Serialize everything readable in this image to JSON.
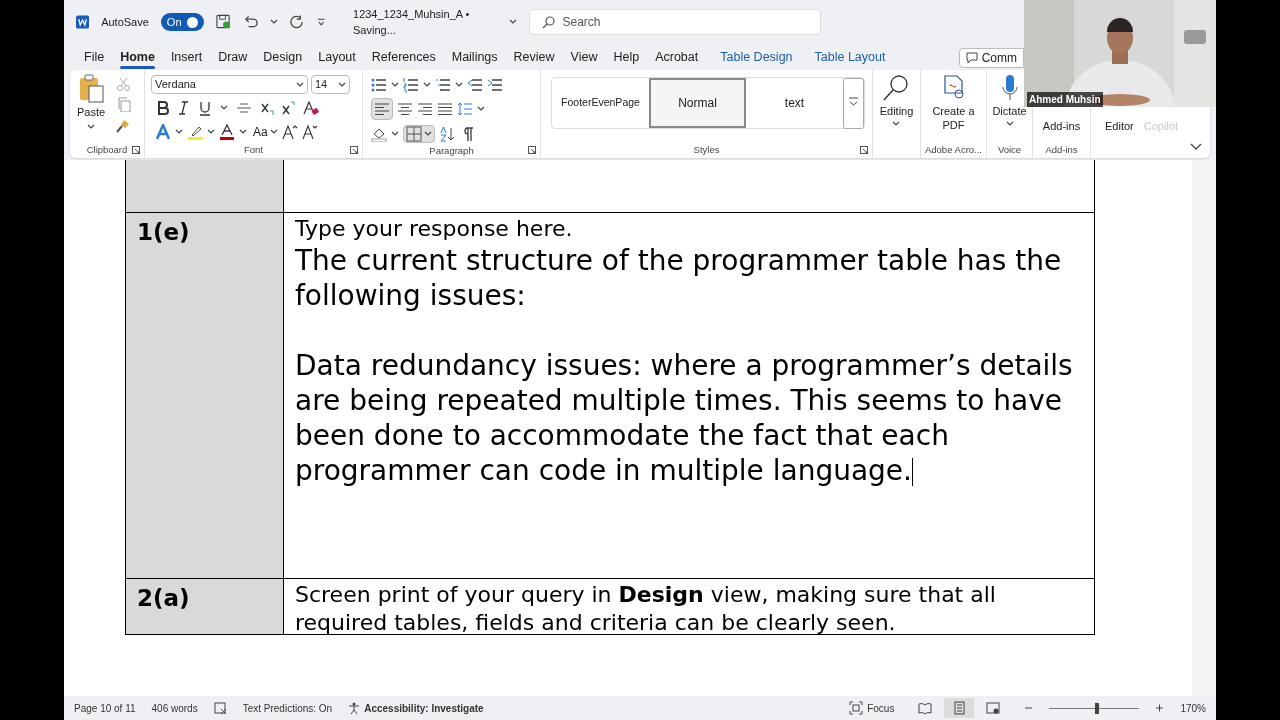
{
  "title_bar": {
    "autosave_label": "AutoSave",
    "autosave_toggle": {
      "label": "On",
      "on": true
    },
    "document_title": "1234_1234_Muhsin_A • Saving...",
    "search": {
      "placeholder": "Search"
    }
  },
  "menu_tabs": [
    {
      "label": "File",
      "selected": false,
      "kind": "normal"
    },
    {
      "label": "Home",
      "selected": true,
      "kind": "normal"
    },
    {
      "label": "Insert",
      "selected": false,
      "kind": "normal"
    },
    {
      "label": "Draw",
      "selected": false,
      "kind": "normal"
    },
    {
      "label": "Design",
      "selected": false,
      "kind": "normal"
    },
    {
      "label": "Layout",
      "selected": false,
      "kind": "normal"
    },
    {
      "label": "References",
      "selected": false,
      "kind": "normal"
    },
    {
      "label": "Mailings",
      "selected": false,
      "kind": "normal"
    },
    {
      "label": "Review",
      "selected": false,
      "kind": "normal"
    },
    {
      "label": "View",
      "selected": false,
      "kind": "normal"
    },
    {
      "label": "Help",
      "selected": false,
      "kind": "normal"
    },
    {
      "label": "Acrobat",
      "selected": false,
      "kind": "normal"
    },
    {
      "label": "Table Design",
      "selected": false,
      "kind": "contextual"
    },
    {
      "label": "Table Layout",
      "selected": false,
      "kind": "contextual"
    }
  ],
  "comments_button": "Comm",
  "ribbon": {
    "clipboard": {
      "paste": "Paste",
      "label": "Clipboard"
    },
    "font": {
      "font_name": "Verdana",
      "font_size": "14",
      "change_case": "Aa",
      "label": "Font"
    },
    "paragraph": {
      "label": "Paragraph"
    },
    "styles": {
      "items": [
        {
          "label": "FooterEvenPage",
          "selected": false
        },
        {
          "label": "Normal",
          "selected": true
        },
        {
          "label": "text",
          "selected": false
        }
      ],
      "label": "Styles"
    },
    "editing": "Editing",
    "create_pdf": "Create a PDF",
    "adobe_label": "Adobe Acro...",
    "dictate": "Dictate",
    "voice_label": "Voice",
    "add_ins": "Add-ins",
    "add_ins_label": "Add-ins",
    "editor": "Editor",
    "copilot": {
      "label": "Copilot",
      "disabled": true
    }
  },
  "video_overlay": {
    "name": "Ahmed Muhsin"
  },
  "document_table": {
    "rows": [
      {
        "label": "",
        "paragraphs": []
      },
      {
        "label": "1(e)",
        "prompt": "Type your response here.",
        "paragraphs": [
          "The current structure of the programmer table has the following issues:",
          "Data redundancy issues: where a programmer’s details are being repeated multiple times. This seems to have been done to accommodate the fact that each programmer can code in multiple language."
        ]
      },
      {
        "label": "2(a)",
        "prompt": "Screen print of your query in **Design** view, making sure that all required tables, fields and criteria can be clearly seen.",
        "paragraphs": []
      }
    ]
  },
  "status_bar": {
    "page": "Page 10 of 11",
    "words": "406 words",
    "text_predictions": "Text Predictions: On",
    "accessibility": "Accessibility: Investigate",
    "focus": "Focus",
    "views": [
      {
        "kind": "read",
        "selected": false
      },
      {
        "kind": "print",
        "selected": true
      },
      {
        "kind": "web",
        "selected": false
      }
    ],
    "zoom": {
      "level": 0.53,
      "reading": "170%"
    }
  }
}
